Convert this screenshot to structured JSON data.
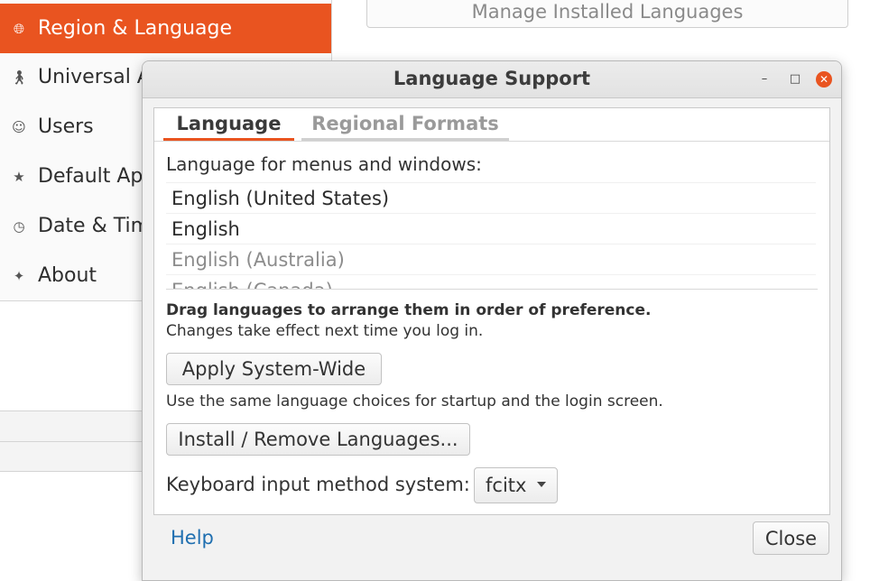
{
  "background": {
    "manage_button": "Manage Installed Languages",
    "sidebar": [
      {
        "label": "Region & Language",
        "icon": "globe-icon",
        "active": true
      },
      {
        "label": "Universal A",
        "icon": "accessibility-icon",
        "active": false
      },
      {
        "label": "Users",
        "icon": "users-icon",
        "active": false
      },
      {
        "label": "Default Ap",
        "icon": "star-icon",
        "active": false
      },
      {
        "label": "Date & Tim",
        "icon": "clock-icon",
        "active": false
      },
      {
        "label": "About",
        "icon": "about-icon",
        "active": false
      }
    ]
  },
  "dialog": {
    "title": "Language Support",
    "tabs": [
      {
        "label": "Language",
        "active": true
      },
      {
        "label": "Regional Formats",
        "active": false
      }
    ],
    "language_label": "Language for menus and windows:",
    "languages": [
      {
        "label": "English (United States)",
        "installed": true
      },
      {
        "label": "English",
        "installed": true
      },
      {
        "label": "English (Australia)",
        "installed": false
      },
      {
        "label": "English (Canada)",
        "installed": false
      }
    ],
    "drag_note": "Drag languages to arrange them in order of preference.",
    "changes_note": "Changes take effect next time you log in.",
    "apply_button": "Apply System-Wide",
    "same_note": "Use the same language choices for startup and the login screen.",
    "install_button": "Install / Remove Languages...",
    "keyboard_label": "Keyboard input method system:",
    "keyboard_value": "fcitx",
    "help": "Help",
    "close": "Close"
  },
  "colors": {
    "accent": "#e95420",
    "link": "#1f6fb0"
  }
}
